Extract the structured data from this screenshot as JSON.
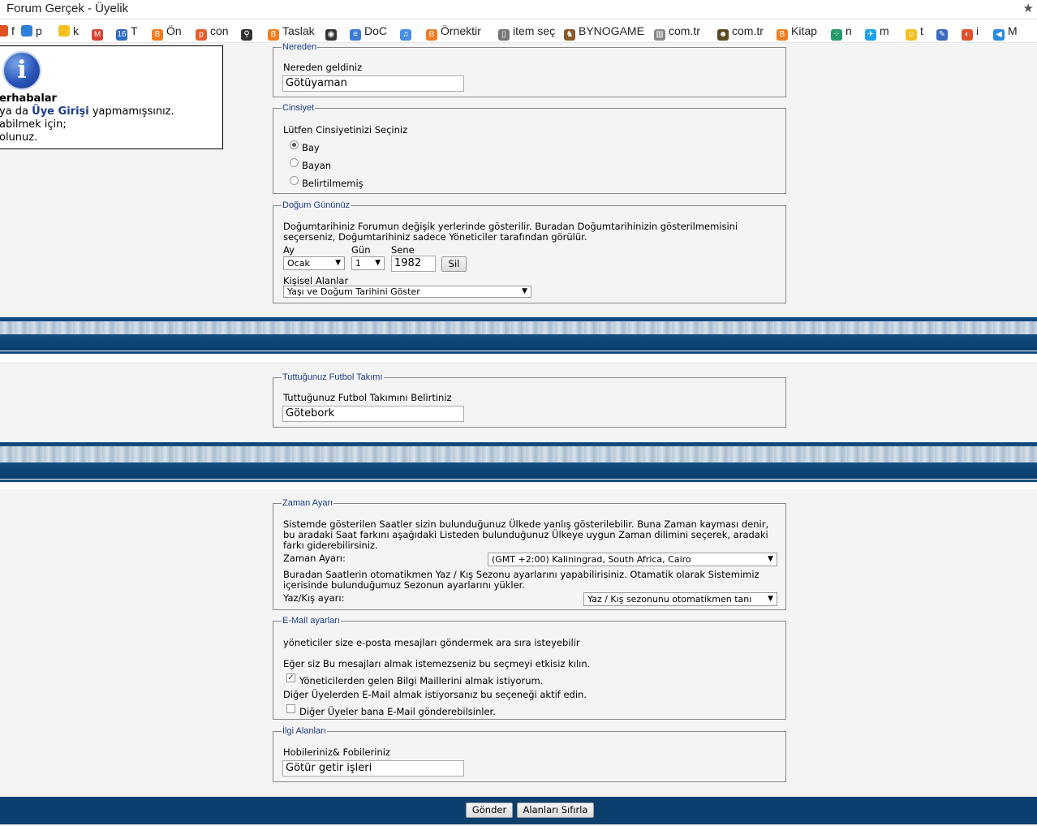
{
  "window": {
    "title": "Forum Gerçek - Üyelik"
  },
  "bookmarks": [
    {
      "label": "f",
      "color": "#e05020"
    },
    {
      "label": "p",
      "color": "#2f80d8"
    },
    {
      "label": "k",
      "color": "#f4c020"
    },
    {
      "label": "",
      "color": "#d84030",
      "glyph": "M"
    },
    {
      "label": "T",
      "color": "#2b6ac0",
      "glyph": "16"
    },
    {
      "label": "Ön",
      "color": "#f47b20",
      "glyph": "B"
    },
    {
      "label": "con",
      "color": "#e06030",
      "glyph": "p"
    },
    {
      "label": "",
      "color": "#333333",
      "glyph": "⚲"
    },
    {
      "label": "Taslak",
      "color": "#f47b20",
      "glyph": "B"
    },
    {
      "label": "",
      "color": "#333333",
      "glyph": "◉"
    },
    {
      "label": "DoC",
      "color": "#3d7bd8",
      "glyph": "≡"
    },
    {
      "label": "",
      "color": "#4a8fe0",
      "glyph": "♫"
    },
    {
      "label": "Örnektir",
      "color": "#f47b20",
      "glyph": "B"
    },
    {
      "label": "item seç",
      "color": "#777777",
      "glyph": "▯"
    },
    {
      "label": "BYNOGAME",
      "color": "#8a5a2a",
      "glyph": "♞"
    },
    {
      "label": "com.tr",
      "color": "#888888",
      "glyph": "▥"
    },
    {
      "label": "com.tr",
      "color": "#5a4a20",
      "glyph": "☻"
    },
    {
      "label": "Kitap",
      "color": "#f47b20",
      "glyph": "B"
    },
    {
      "label": "n",
      "color": "#2a9a6a",
      "glyph": "⁘"
    },
    {
      "label": "m",
      "color": "#1da1f2",
      "glyph": "✈"
    },
    {
      "label": "t",
      "color": "#f4c020",
      "glyph": "☺"
    },
    {
      "label": "",
      "color": "#3a6ac0",
      "glyph": "✎"
    },
    {
      "label": "i",
      "color": "#e05030",
      "glyph": "◐"
    },
    {
      "label": "M",
      "color": "#2a8ae0",
      "glyph": "◀"
    }
  ],
  "infobox": {
    "line1": "erhabalar",
    "line2_pre": "ya da ",
    "line2_link": "Üye Girişi",
    "line2_post": " yapmamışsınız.",
    "line3": "abilmek için;",
    "line4": "olunuz."
  },
  "nereden": {
    "legend": "Nereden",
    "label": "Nereden geldiniz",
    "value": "Götüyaman"
  },
  "cinsiyet": {
    "legend": "Cinsiyet",
    "label": "Lütfen Cinsiyetinizi Seçiniz",
    "options": [
      {
        "label": "Bay",
        "selected": true
      },
      {
        "label": "Bayan",
        "selected": false
      },
      {
        "label": "Belirtilmemiş",
        "selected": false
      }
    ]
  },
  "dogum": {
    "legend": "Doğum Gününüz",
    "desc1": "Doğumtarihiniz Forumun değişik yerlerinde gösterilir. Buradan Doğumtarihinizin gösterilmemisini",
    "desc2": "seçerseniz, Doğumtarihiniz sadece Yöneticiler tarafından görülür.",
    "ay_label": "Ay",
    "ay_value": "Ocak",
    "gun_label": "Gün",
    "gun_value": "1",
    "sene_label": "Sene",
    "sene_value": "1982",
    "sil_button": "Sil",
    "kisisel_label": "Kişisel Alanlar",
    "kisisel_value": "Yaşı ve Doğum Tarihini Göster"
  },
  "futbol": {
    "legend": "Tuttuğunuz Futbol Takımı",
    "label": "Tuttuğunuz Futbol Takımını Belirtiniz",
    "value": "Götebork"
  },
  "zaman": {
    "legend": "Zaman Ayarı",
    "desc1": "Sistemde gösterilen Saatler sizin bulunduğunuz Ülkede yanlış gösterilebilir. Buna Zaman kayması denir,",
    "desc2": "bu aradaki Saat farkını aşağıdaki Listeden bulunduğunuz Ülkeye uygun Zaman dilimini seçerek, aradaki",
    "desc3": "farkı giderebilirsiniz.",
    "zaman_label": "Zaman Ayarı:",
    "zaman_value": "(GMT +2:00) Kaliningrad, South Africa, Cairo",
    "desc4": "Buradan Saatlerin otomatikmen Yaz / Kış Sezonu ayarlarını yapabilirisiniz. Otamatik olarak Sistemimiz",
    "desc5": "içerisinde bulunduğumuz Sezonun ayarlarını yükler.",
    "yazkis_label": "Yaz/Kış ayarı:",
    "yazkis_value": "Yaz / Kış sezonunu otomatikmen tanı"
  },
  "email": {
    "legend": "E-Mail ayarları",
    "line1": "yöneticiler size e-posta mesajları göndermek ara sıra isteyebilir",
    "line2": "Eğer siz Bu mesajları almak istemezseniz bu seçmeyi etkisiz kılın.",
    "check1_label": "Yöneticilerden gelen Bilgi Maillerini almak istiyorum.",
    "check1_checked": true,
    "line3": "Diğer Üyelerden E-Mail almak istiyorsanız bu seçeneği aktif edin.",
    "check2_label": "Diğer Üyeler bana E-Mail gönderebilsinler.",
    "check2_checked": false
  },
  "ilgi": {
    "legend": "İlgi Alanları",
    "label": "Hobileriniz& Fobileriniz",
    "value": "Götür getir işleri"
  },
  "footer": {
    "submit": "Gönder",
    "reset": "Alanları Sıfırla"
  }
}
